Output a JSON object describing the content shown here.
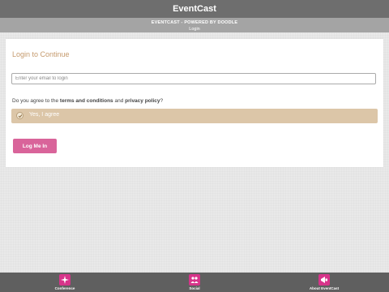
{
  "app": {
    "title": "EventCast",
    "subtitle": "EVENTCAST - POWERED BY DOODLE",
    "page": "Login"
  },
  "login": {
    "heading": "Login to Continue",
    "email_placeholder": "Enter your email to login",
    "email_value": "",
    "agree_prefix": "Do you agree to the",
    "terms_link": "terms and conditions",
    "agree_and": "and",
    "privacy_link": "privacy policy",
    "agree_suffix": "?",
    "agree_option": "Yes, I agree",
    "agree_checked": true,
    "button": "Log Me In"
  },
  "tabs": [
    {
      "label": "Conference",
      "icon": "sparkle-icon"
    },
    {
      "label": "Social",
      "icon": "people-icon"
    },
    {
      "label": "About EventCast",
      "icon": "megaphone-icon"
    }
  ],
  "colors": {
    "accent": "#d9649a",
    "tab_icon": "#d7348a",
    "heading": "#c59a6d",
    "agree_bg": "#dcc6a8"
  }
}
